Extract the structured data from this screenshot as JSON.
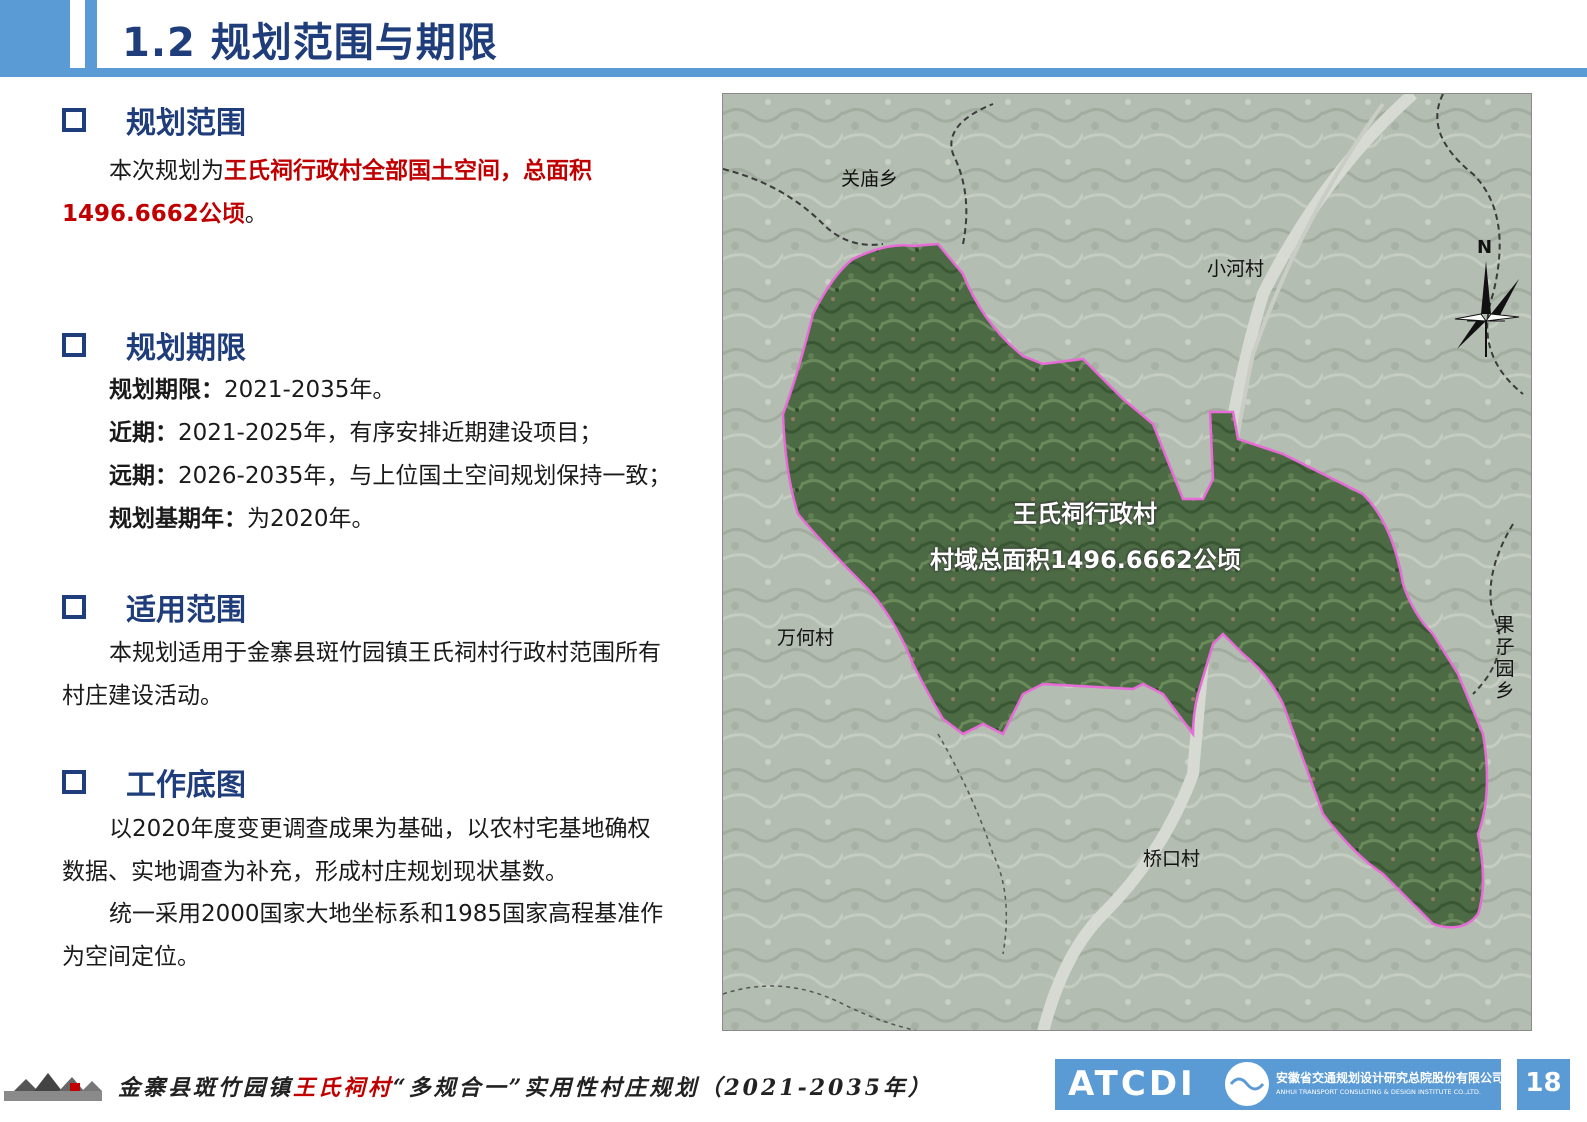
{
  "header": {
    "title": "1.2 规划范围与期限"
  },
  "sections": {
    "scope": {
      "heading": "规划范围",
      "p_prefix": "本次规划为",
      "p_red": "王氏祠行政村全部国土空间，总面积",
      "p_red2": "1496.6662公顷",
      "p_suffix": "。"
    },
    "period": {
      "heading": "规划期限",
      "lines": [
        {
          "label": "规划期限：",
          "text": "2021-2035年。"
        },
        {
          "label": "近期：",
          "text": "2021-2025年，有序安排近期建设项目；"
        },
        {
          "label": "远期：",
          "text": "2026-2035年，与上位国土空间规划保持一致；"
        },
        {
          "label": "规划基期年：",
          "text": "为2020年。"
        }
      ]
    },
    "applicable": {
      "heading": "适用范围",
      "text": "本规划适用于金寨县斑竹园镇王氏祠村行政村范围所有村庄建设活动。"
    },
    "basemap": {
      "heading": "工作底图",
      "text1": "以2020年度变更调查成果为基础，以农村宅基地确权数据、实地调查为补充，形成村庄规划现状基数。",
      "text2": "统一采用2000国家大地坐标系和1985国家高程基准作为空间定位。"
    }
  },
  "map": {
    "labels": {
      "guanmiao": "关庙乡",
      "xiaohe": "小河村",
      "wanhe": "万何村",
      "qiaokou": "桥口村",
      "guoziyuan": "果子园乡"
    },
    "center_line1": "王氏祠行政村",
    "center_line2": "村域总面积1496.6662公顷",
    "north": "N",
    "boundary_color": "#e86bd8"
  },
  "footer": {
    "title_prefix": "金寨县斑竹园镇",
    "title_red": "王氏祠村",
    "title_suffix": "“多规合一”实用性村庄规划（2021-2035年）",
    "logo_text": "ATCDI",
    "company_cn": "安徽省交通规划设计研究总院股份有限公司",
    "company_en": "ANHUI TRANSPORT CONSULTING & DESIGN INSTITUTE CO.,LTD.",
    "page_number": "18"
  }
}
